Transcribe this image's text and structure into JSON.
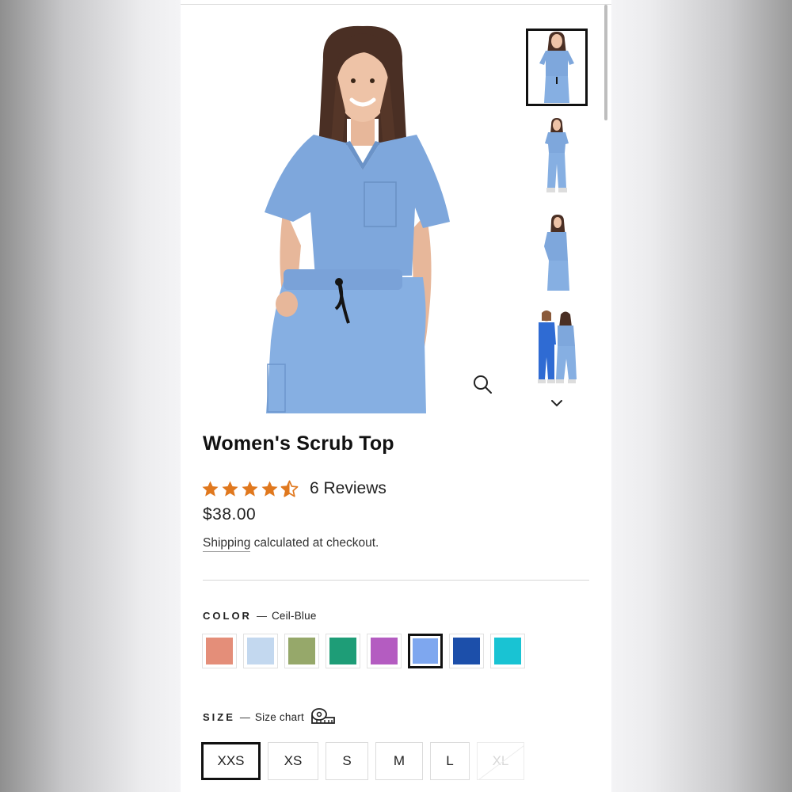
{
  "product": {
    "title": "Women's Scrub Top",
    "rating": 4.5,
    "reviews_label": "6 Reviews",
    "price": "$38.00",
    "shipping_link": "Shipping",
    "shipping_rest": "calculated at checkout."
  },
  "gallery": {
    "main_icon": "person-photo-icon",
    "zoom_icon": "zoom-icon",
    "next_icon": "chevron-down-icon",
    "selected_thumbnail": 0,
    "scrub_color": "#7ea7dc"
  },
  "color_option": {
    "label": "COLOR",
    "dash": "—",
    "value": "Ceil-Blue",
    "swatches": [
      "#e48e79",
      "#c3d8ef",
      "#96a86a",
      "#1e9d77",
      "#b45cc1",
      "#7ea7ef",
      "#1c4faa",
      "#19c3d3"
    ],
    "selected_index": 5
  },
  "size_option": {
    "label": "SIZE",
    "dash": "—",
    "value": "Size chart",
    "ruler_icon": "tape-measure-icon",
    "sizes": [
      "XXS",
      "XS",
      "S",
      "M",
      "L",
      "XL"
    ],
    "selected_index": 0,
    "disabled_index": 5
  },
  "colors": {
    "star": "#e0781e",
    "text": "#111111"
  }
}
